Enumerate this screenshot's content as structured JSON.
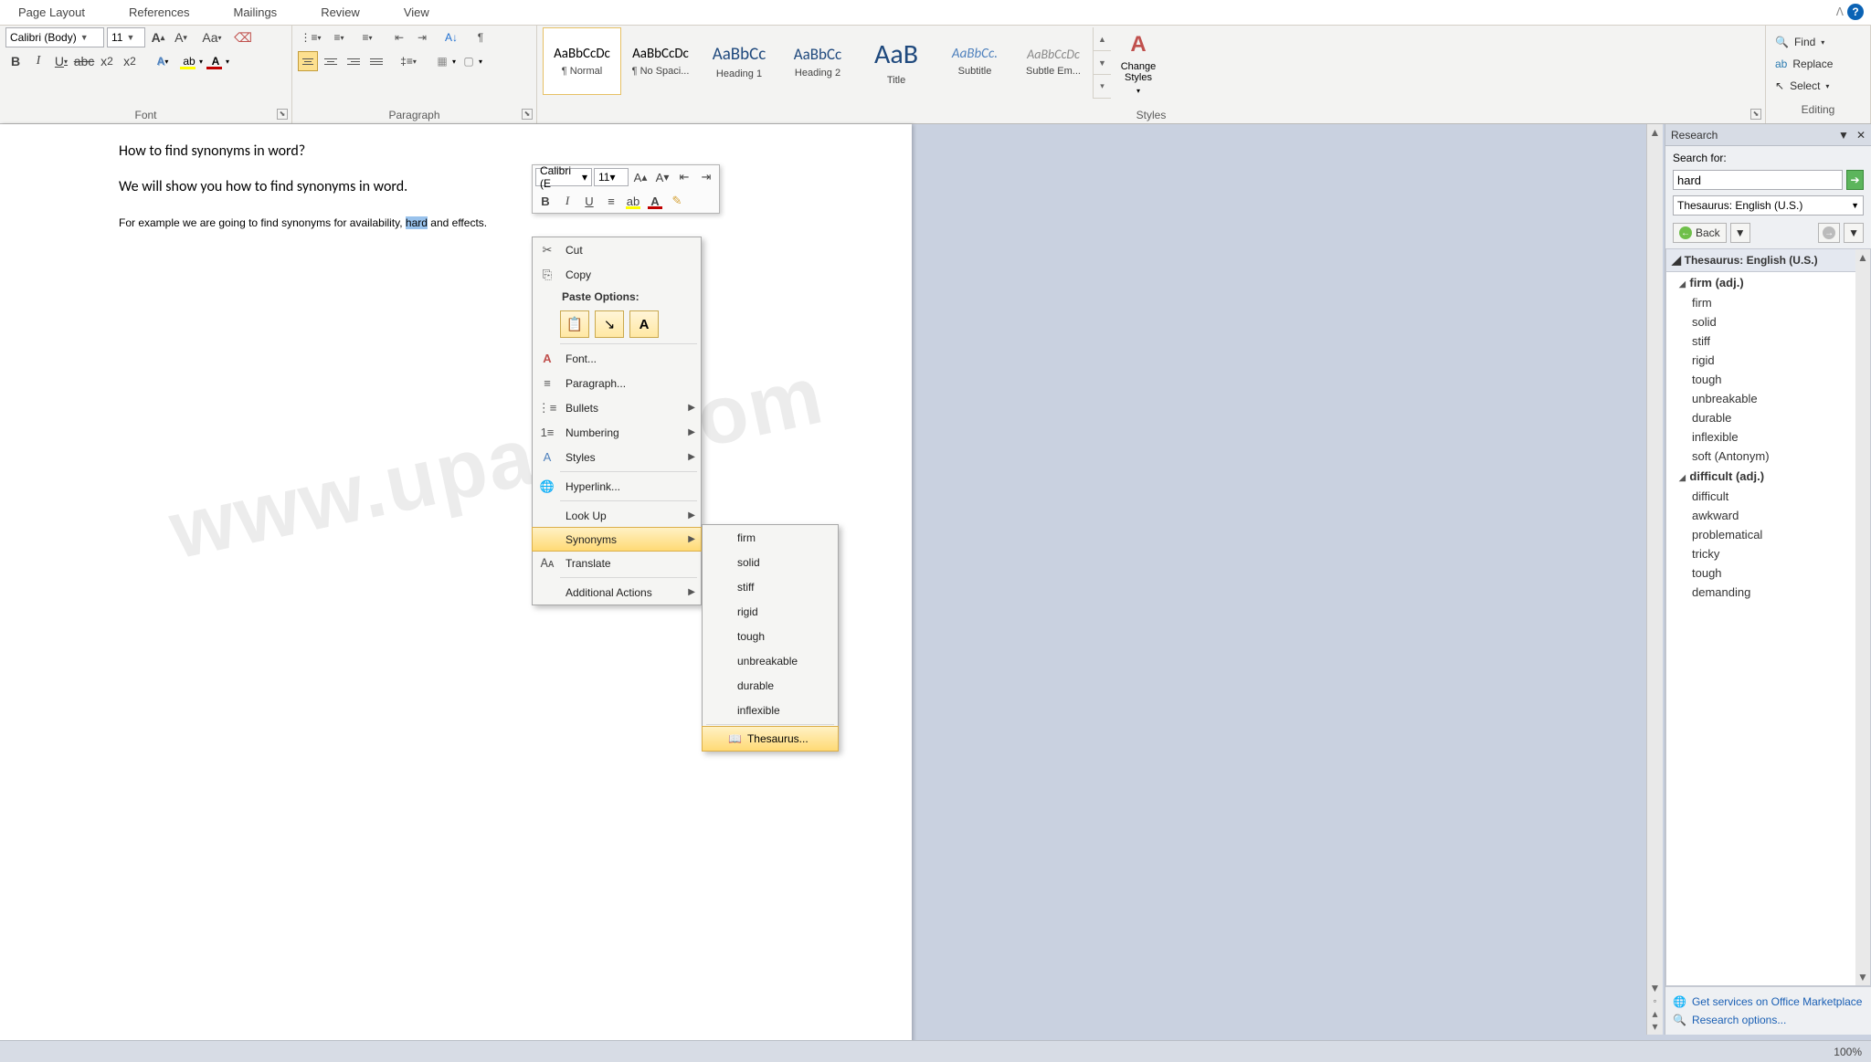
{
  "tabs": {
    "pageLayout": "Page Layout",
    "references": "References",
    "mailings": "Mailings",
    "review": "Review",
    "view": "View"
  },
  "ribbon": {
    "font": {
      "label": "Font",
      "family": "Calibri (Body)",
      "size": "11"
    },
    "paragraph": {
      "label": "Paragraph"
    },
    "styles": {
      "label": "Styles",
      "items": [
        {
          "preview": "AaBbCcDc",
          "name": "¶ Normal",
          "font": "15px",
          "color": "#000"
        },
        {
          "preview": "AaBbCcDc",
          "name": "¶ No Spaci...",
          "font": "15px",
          "color": "#000"
        },
        {
          "preview": "AaBbCc",
          "name": "Heading 1",
          "font": "19px",
          "color": "#1f497d"
        },
        {
          "preview": "AaBbCc",
          "name": "Heading 2",
          "font": "17px",
          "color": "#1f497d"
        },
        {
          "preview": "AaB",
          "name": "Title",
          "font": "30px",
          "color": "#1f497d"
        },
        {
          "preview": "AaBbCc.",
          "name": "Subtitle",
          "font": "15px",
          "color": "#4f81bd",
          "italic": true
        },
        {
          "preview": "AaBbCcDc",
          "name": "Subtle Em...",
          "font": "14px",
          "color": "#888",
          "italic": true
        }
      ],
      "changeStyles": "Change Styles"
    },
    "editing": {
      "label": "Editing",
      "find": "Find",
      "replace": "Replace",
      "select": "Select"
    }
  },
  "document": {
    "p1": "How to find synonyms in word?",
    "p2": "We will show you how to find synonyms in word.",
    "p3a": "For example we are going to find synonyms for availability, ",
    "p3_sel": "hard",
    "p3b": " and effects."
  },
  "miniToolbar": {
    "font": "Calibri (E",
    "size": "11"
  },
  "contextMenu": {
    "cut": "Cut",
    "copy": "Copy",
    "pasteHead": "Paste Options:",
    "font": "Font...",
    "paragraph": "Paragraph...",
    "bullets": "Bullets",
    "numbering": "Numbering",
    "styles": "Styles",
    "hyperlink": "Hyperlink...",
    "lookup": "Look Up",
    "synonyms": "Synonyms",
    "translate": "Translate",
    "additional": "Additional Actions"
  },
  "synonymsFlyout": {
    "items": [
      "firm",
      "solid",
      "stiff",
      "rigid",
      "tough",
      "unbreakable",
      "durable",
      "inflexible"
    ],
    "thesaurus": "Thesaurus..."
  },
  "research": {
    "title": "Research",
    "searchFor": "Search for:",
    "query": "hard",
    "source": "Thesaurus: English (U.S.)",
    "back": "Back",
    "resultsHead": "Thesaurus: English (U.S.)",
    "group1": "firm (adj.)",
    "g1items": [
      "firm",
      "solid",
      "stiff",
      "rigid",
      "tough",
      "unbreakable",
      "durable",
      "inflexible",
      "soft (Antonym)"
    ],
    "group2": "difficult (adj.)",
    "g2items": [
      "difficult",
      "awkward",
      "problematical",
      "tricky",
      "tough",
      "demanding"
    ],
    "link1": "Get services on Office Marketplace",
    "link2": "Research options..."
  },
  "status": {
    "zoom": "100%"
  },
  "watermark": "www.upaae.com"
}
